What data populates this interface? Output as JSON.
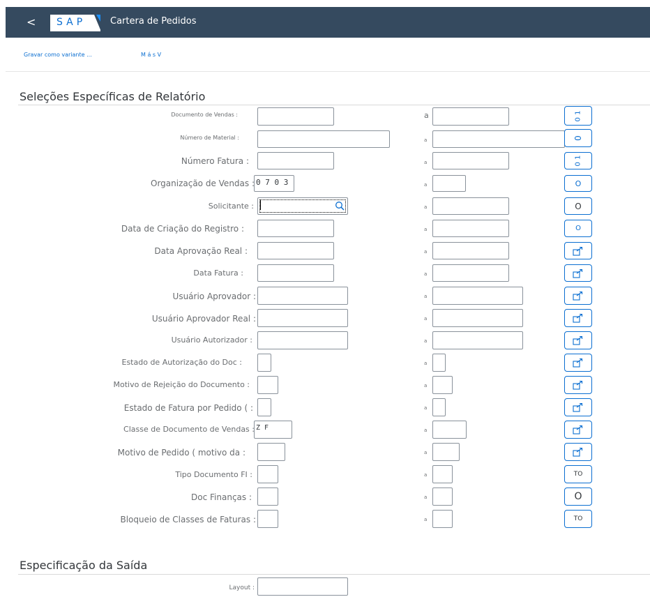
{
  "shell": {
    "back_label": "<",
    "logo_text": "SAP",
    "title": "Cartera de Pedidos"
  },
  "toolbar": {
    "save_variant_label": "Gravar como variante ...",
    "more_label": "M á s V"
  },
  "sections": {
    "selections_title": "Seleções Específicas de Relatório",
    "output_title": "Especificação da Saída"
  },
  "range_separator": "a",
  "fields": [
    {
      "label": "Documento de Vendas :",
      "low": "",
      "high": "",
      "multi": "0 1"
    },
    {
      "label": "Número de Material :",
      "low": "",
      "high": "",
      "multi": "0"
    },
    {
      "label": "Número Fatura :",
      "low": "",
      "high": "",
      "multi": "0 1"
    },
    {
      "label": "Organização de Vendas :",
      "low": "0 7 0 3",
      "high": "",
      "multi": "O"
    },
    {
      "label": "Solicitante :",
      "low": "",
      "high": "",
      "multi": "O"
    },
    {
      "label": "Data de Criação do Registro :",
      "low": "",
      "high": "",
      "multi": "O"
    },
    {
      "label": "Data Aprovação Real :",
      "low": "",
      "high": "",
      "multi": ""
    },
    {
      "label": "Data Fatura :",
      "low": "",
      "high": "",
      "multi": ""
    },
    {
      "label": "Usuário Aprovador :",
      "low": "",
      "high": "",
      "multi": ""
    },
    {
      "label": "Usuário Aprovador Real :",
      "low": "",
      "high": "",
      "multi": ""
    },
    {
      "label": "Usuário Autorizador :",
      "low": "",
      "high": "",
      "multi": ""
    },
    {
      "label": "Estado de Autorização do Doc :",
      "low": "",
      "high": "",
      "multi": ""
    },
    {
      "label": "Motivo de Rejeição do Documento :",
      "low": "",
      "high": "",
      "multi": ""
    },
    {
      "label": "Estado de Fatura por Pedido ( :",
      "low": "",
      "high": "",
      "multi": ""
    },
    {
      "label": "Classe de Documento de Vendas :",
      "low": "Z F",
      "high": "",
      "multi": ""
    },
    {
      "label": "Motivo de Pedido ( motivo da :",
      "low": "",
      "high": "",
      "multi": ""
    },
    {
      "label": "Tipo Documento FI :",
      "low": "",
      "high": "",
      "multi": "TO"
    },
    {
      "label": "Doc Finanças :",
      "low": "",
      "high": "",
      "multi": "O"
    },
    {
      "label": "Bloqueio de Classes de Faturas :",
      "low": "",
      "high": "",
      "multi": "TO"
    }
  ],
  "output": {
    "layout_label": "Layout :",
    "layout_value": ""
  },
  "icons": {
    "search": "search-icon",
    "multiple_selection": "multiple-selection-icon"
  },
  "colors": {
    "shell": "#354a5f",
    "accent": "#0a6ed1"
  }
}
